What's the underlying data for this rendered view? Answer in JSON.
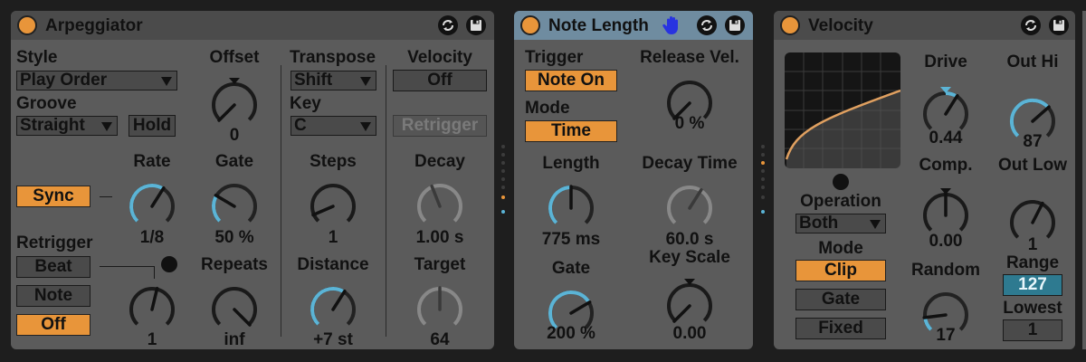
{
  "colors": {
    "accent_orange": "#e8953a",
    "knob_blue": "#5bb4d6",
    "knob_gray": "#8a8a8a",
    "range_teal": "#2e7a90"
  },
  "arpeggiator": {
    "title": "Arpeggiator",
    "style_label": "Style",
    "style_value": "Play Order",
    "groove_label": "Groove",
    "groove_value": "Straight",
    "hold_label": "Hold",
    "offset_label": "Offset",
    "offset_value": "0",
    "transpose_label": "Transpose",
    "transpose_value": "Shift",
    "key_label": "Key",
    "key_value": "C",
    "velocity_label": "Velocity",
    "velocity_value": "Off",
    "retrigger_button": "Retrigger",
    "sync_label": "Sync",
    "rate_label": "Rate",
    "rate_value": "1/8",
    "gate_label": "Gate",
    "gate_value": "50 %",
    "steps_label": "Steps",
    "steps_value": "1",
    "decay_label": "Decay",
    "decay_value": "1.00 s",
    "retrigger_label": "Retrigger",
    "retrigger_options": [
      "Beat",
      "Note",
      "Off"
    ],
    "retrigger_value": "1",
    "repeats_label": "Repeats",
    "repeats_value": "inf",
    "distance_label": "Distance",
    "distance_value": "+7 st",
    "target_label": "Target",
    "target_value": "64"
  },
  "note_length": {
    "title": "Note Length",
    "trigger_label": "Trigger",
    "trigger_value": "Note On",
    "mode_label": "Mode",
    "mode_value": "Time",
    "release_vel_label": "Release Vel.",
    "release_vel_value": "0 %",
    "length_label": "Length",
    "length_value": "775 ms",
    "decay_time_label": "Decay Time",
    "decay_time_value": "60.0 s",
    "gate_label": "Gate",
    "gate_value": "200 %",
    "key_scale_label": "Key Scale",
    "key_scale_value": "0.00"
  },
  "velocity": {
    "title": "Velocity",
    "operation_label": "Operation",
    "operation_value": "Both",
    "mode_label": "Mode",
    "mode_options": [
      "Clip",
      "Gate",
      "Fixed"
    ],
    "drive_label": "Drive",
    "drive_value": "0.44",
    "comp_label": "Comp.",
    "comp_value": "0.00",
    "random_label": "Random",
    "random_value": "17",
    "out_hi_label": "Out Hi",
    "out_hi_value": "87",
    "out_low_label": "Out Low",
    "out_low_value": "1",
    "range_label": "Range",
    "range_value": "127",
    "lowest_label": "Lowest",
    "lowest_value": "1"
  }
}
